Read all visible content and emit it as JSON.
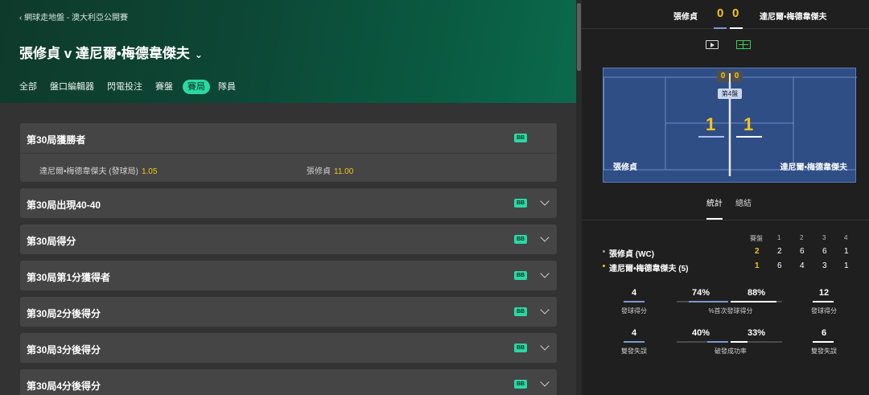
{
  "breadcrumb": "‹ 網球走地盤 - 澳大利亞公開賽",
  "match_title": "張修貞 v 達尼爾•梅德韋傑夫",
  "tabs": [
    {
      "label": "全部",
      "active": false
    },
    {
      "label": "盤口編輯器",
      "active": false
    },
    {
      "label": "閃電投注",
      "active": false
    },
    {
      "label": "賽盤",
      "active": false
    },
    {
      "label": "賽局",
      "active": true
    },
    {
      "label": "隊員",
      "active": false
    }
  ],
  "bb_label": "BB",
  "markets": [
    {
      "name": "第30局獲勝者",
      "expanded": true,
      "selections": [
        {
          "label": "達尼爾•梅德韋傑夫 (發球局)",
          "odds": "1.05"
        },
        {
          "label": "張修貞",
          "odds": "11.00"
        }
      ]
    },
    {
      "name": "第30局出現40-40",
      "expanded": false
    },
    {
      "name": "第30局得分",
      "expanded": false
    },
    {
      "name": "第30局第1分獲得者",
      "expanded": false
    },
    {
      "name": "第30局2分後得分",
      "expanded": false
    },
    {
      "name": "第30局3分後得分",
      "expanded": false
    },
    {
      "name": "第30局4分後得分",
      "expanded": false
    }
  ],
  "scoreboard": {
    "player1": "張修貞",
    "player2": "達尼爾•梅德韋傑夫",
    "score1": "0",
    "score2": "0"
  },
  "court": {
    "point1": "0",
    "point2": "0",
    "set_label": "第4盤",
    "games1": "1",
    "games2": "1",
    "player1": "張修貞",
    "player2": "達尼爾•梅德韋傑夫"
  },
  "stat_tabs": [
    "統計",
    "總結"
  ],
  "table": {
    "headers": [
      "賽盤",
      "1",
      "2",
      "3",
      "4"
    ],
    "rows": [
      {
        "name": "張修貞 (WC)",
        "sets": "2",
        "scores": [
          "2",
          "6",
          "6",
          "1"
        ],
        "dot_color": "#9a9a9a"
      },
      {
        "name": "達尼爾•梅德韋傑夫 (5)",
        "sets": "1",
        "scores": [
          "6",
          "4",
          "3",
          "1"
        ],
        "dot_color": "#f5c518"
      }
    ]
  },
  "stats": [
    {
      "v1": "4",
      "p1": "74%",
      "p2": "88%",
      "v2": "12",
      "label_left": "發球得分",
      "label_mid": "%首次發球得分",
      "label_right": "發球得分"
    },
    {
      "v1": "4",
      "p1": "40%",
      "p2": "33%",
      "v2": "6",
      "label_left": "雙發失誤",
      "label_mid": "破發成功率",
      "label_right": "雙發失誤"
    }
  ]
}
